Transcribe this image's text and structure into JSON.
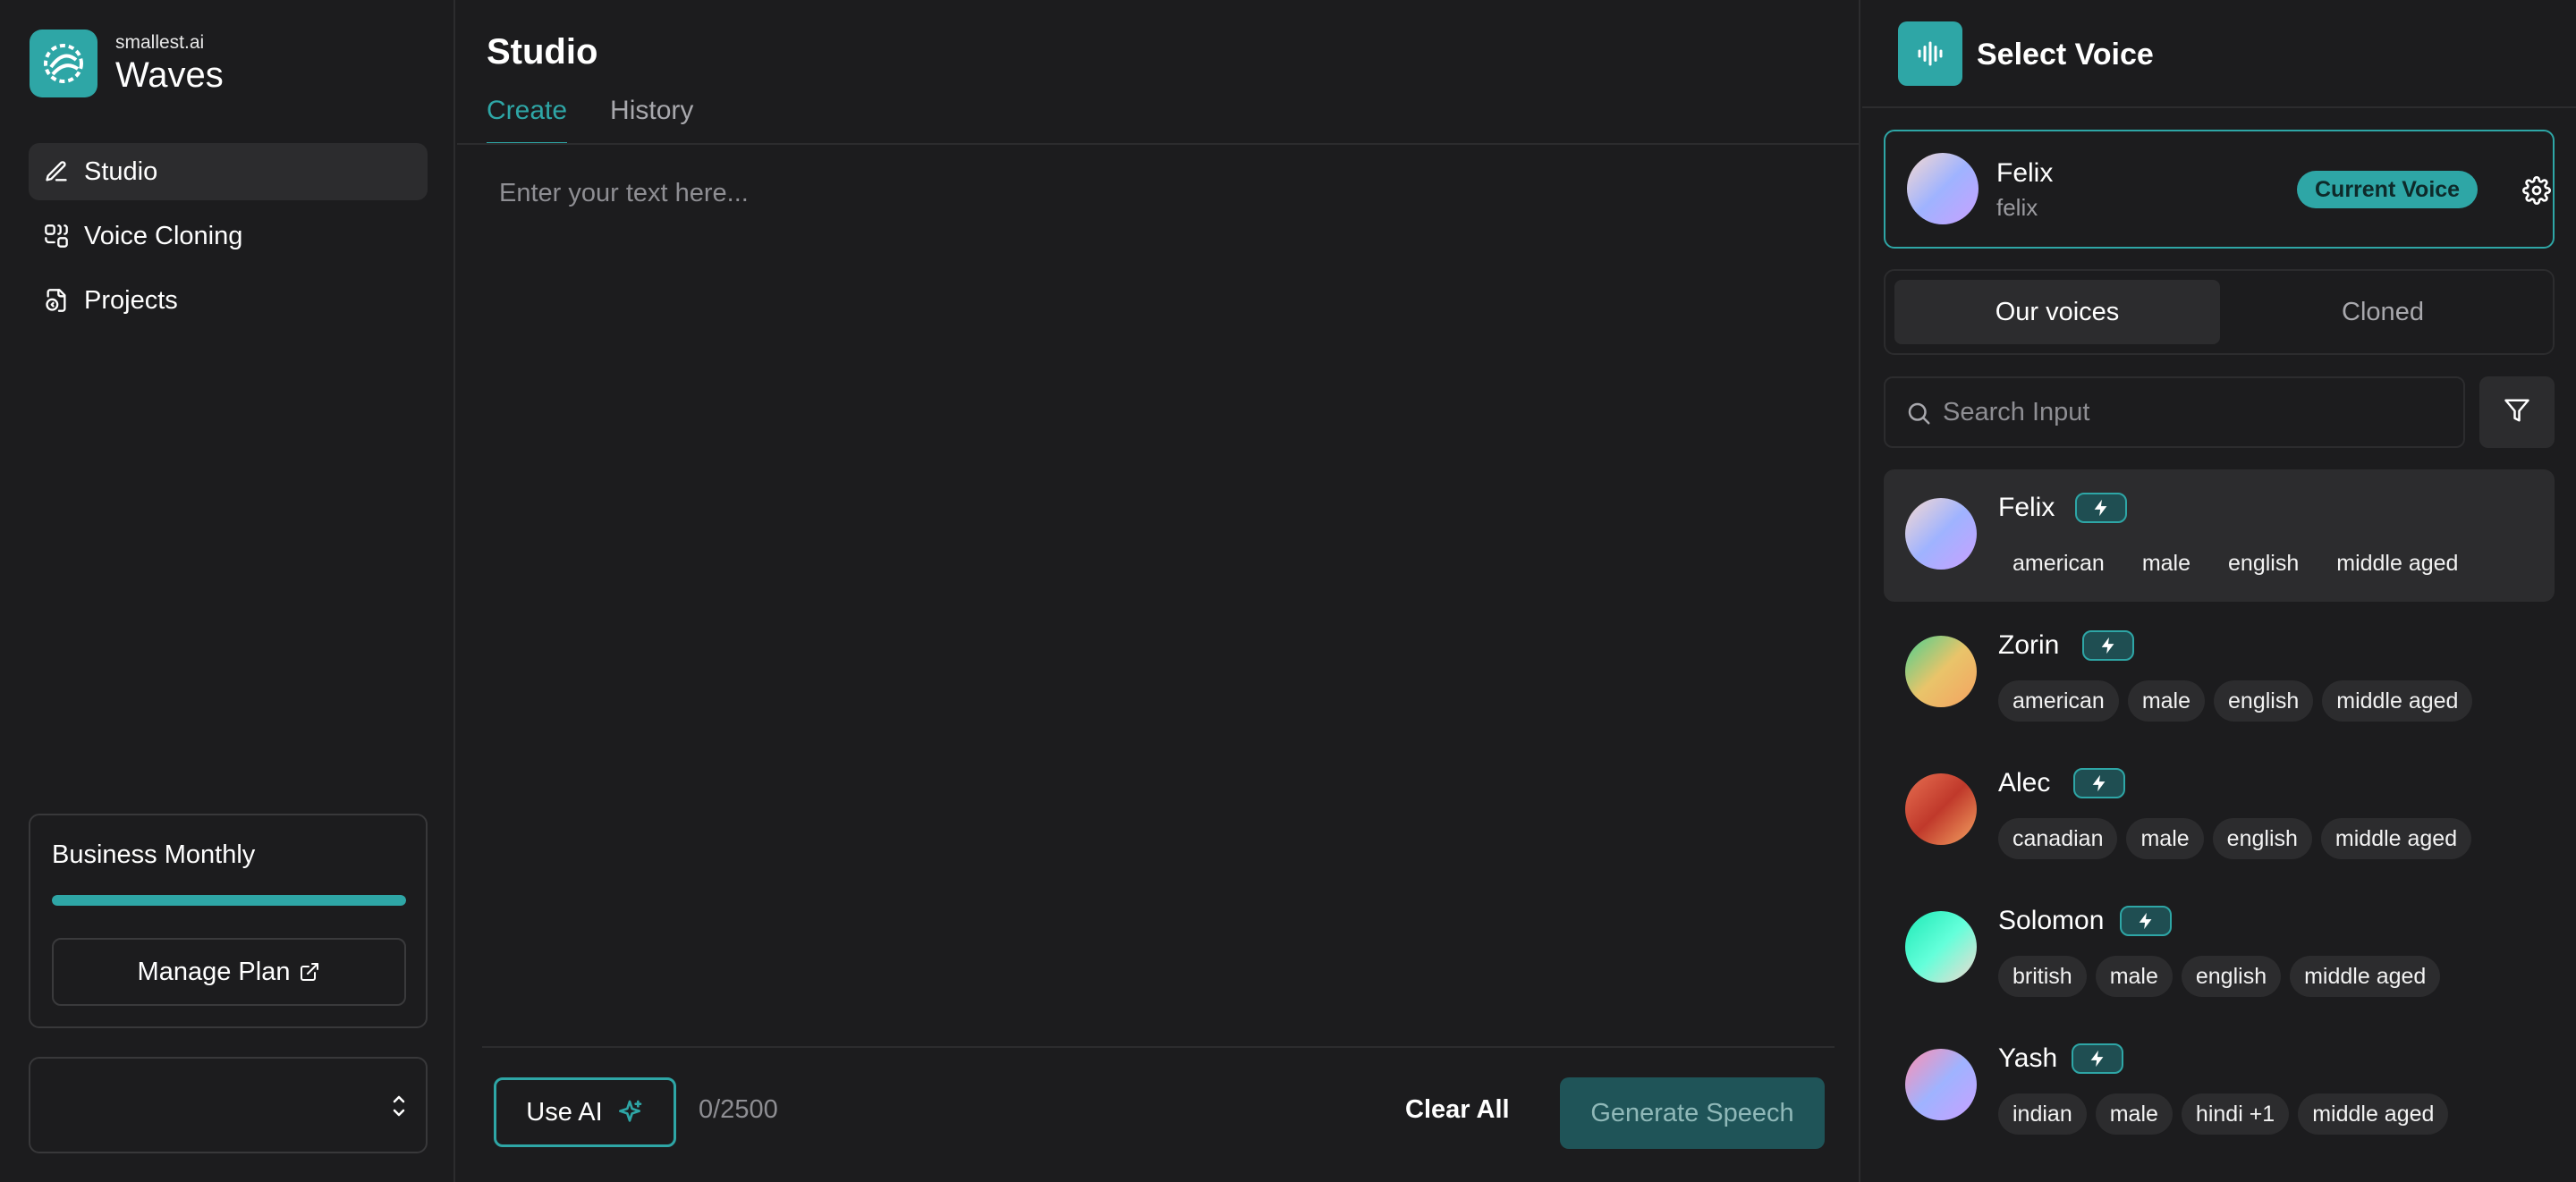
{
  "brand": {
    "sub": "smallest.ai",
    "name": "Waves"
  },
  "nav": [
    {
      "label": "Studio",
      "icon": "pencil-icon",
      "active": true
    },
    {
      "label": "Voice Cloning",
      "icon": "voice-cloning-icon",
      "active": false
    },
    {
      "label": "Projects",
      "icon": "projects-icon",
      "active": false
    }
  ],
  "plan": {
    "title": "Business Monthly",
    "usage_fraction": 1.0,
    "manage_label": "Manage Plan"
  },
  "studio": {
    "title": "Studio",
    "tabs": [
      "Create",
      "History"
    ],
    "editor_placeholder": "Enter your text here...",
    "use_ai_label": "Use AI",
    "char_count": "0/2500",
    "clear_label": "Clear All",
    "generate_label": "Generate Speech"
  },
  "voice_panel": {
    "title": "Select Voice",
    "current": {
      "name": "Felix",
      "id": "felix",
      "badge": "Current Voice"
    },
    "tabs": [
      "Our voices",
      "Cloned"
    ],
    "search_placeholder": "Search Input",
    "voices": [
      {
        "name": "Felix",
        "tags": [
          "american",
          "male",
          "english",
          "middle aged"
        ],
        "gradient": [
          "#f6d9d0",
          "#9fb3ff",
          "#c9a0ff"
        ],
        "selected": true
      },
      {
        "name": "Zorin",
        "tags": [
          "american",
          "male",
          "english",
          "middle aged"
        ],
        "gradient": [
          "#4ad08f",
          "#e9c46a",
          "#f4a261"
        ],
        "selected": false
      },
      {
        "name": "Alec",
        "tags": [
          "canadian",
          "male",
          "english",
          "middle aged"
        ],
        "gradient": [
          "#e76f51",
          "#c0392b",
          "#f4a261"
        ],
        "selected": false
      },
      {
        "name": "Solomon",
        "tags": [
          "british",
          "male",
          "english",
          "middle aged"
        ],
        "gradient": [
          "#1de9b6",
          "#64ffda",
          "#f6d9d0"
        ],
        "selected": false
      },
      {
        "name": "Yash",
        "tags": [
          "indian",
          "male",
          "hindi +1",
          "middle aged"
        ],
        "gradient": [
          "#ff8fb1",
          "#9fb3ff",
          "#c9a0ff"
        ],
        "selected": false
      }
    ]
  },
  "colors": {
    "accent": "#2ea6a6",
    "background": "#1c1c1e",
    "surface": "#2c2c2e",
    "generate_disabled": "#1f5458"
  }
}
